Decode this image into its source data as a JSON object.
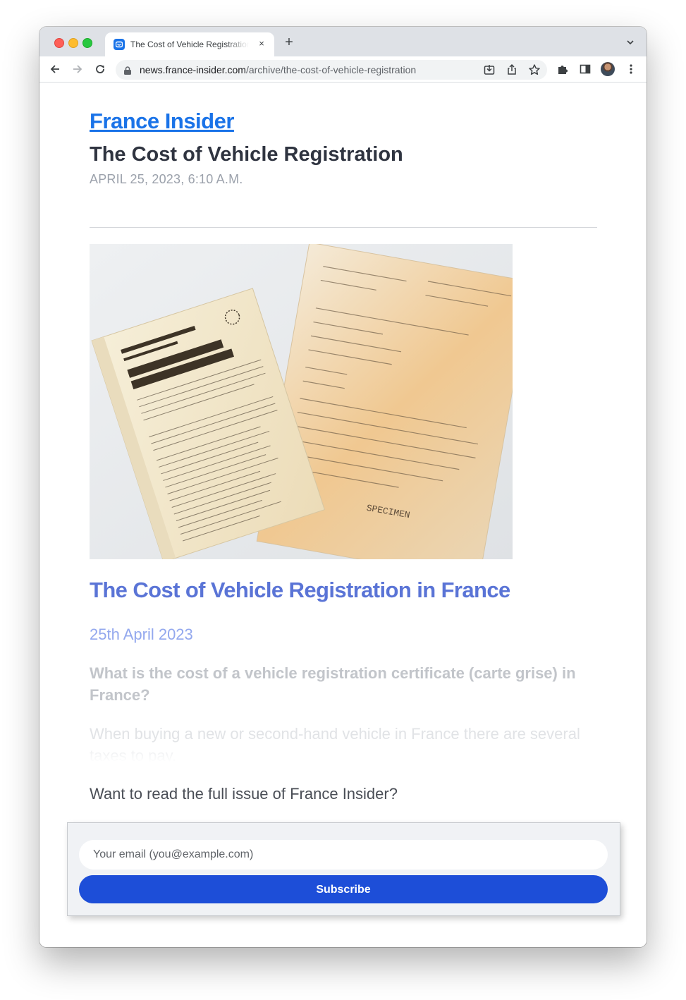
{
  "browser": {
    "tab_title": "The Cost of Vehicle Registration",
    "tab_close": "×",
    "new_tab": "+",
    "url_host": "news.france-insider.com",
    "url_path": "/archive/the-cost-of-vehicle-registration",
    "toolbar_icons": [
      "back-arrow-icon",
      "forward-arrow-icon",
      "reload-icon",
      "lock-icon",
      "download-icon",
      "share-icon",
      "star-icon",
      "extensions-puzzle-icon",
      "side-panel-icon",
      "profile-avatar",
      "more-vertical-icon"
    ]
  },
  "page": {
    "brand": "France Insider",
    "headline": "The Cost of Vehicle Registration",
    "dateline": "APRIL 25, 2023, 6:10 A.M.",
    "hero_image": "vehicle registration certificate documents",
    "article_title": "The Cost of Vehicle Registration in France",
    "article_date": "25th April 2023",
    "teaser_question": "What is the cost of a vehicle registration certificate (carte grise) in France?",
    "teaser_body": "When buying a new or second-hand vehicle in France there are several taxes to pay.",
    "cta": "Want to read the full issue of France Insider?"
  },
  "signup": {
    "email_placeholder": "Your email (you@example.com)",
    "email_value": "",
    "subscribe_label": "Subscribe"
  },
  "colors": {
    "brand": "#1a73e8",
    "article_title": "#5a74d6",
    "subscribe_button": "#1d4ed8"
  }
}
